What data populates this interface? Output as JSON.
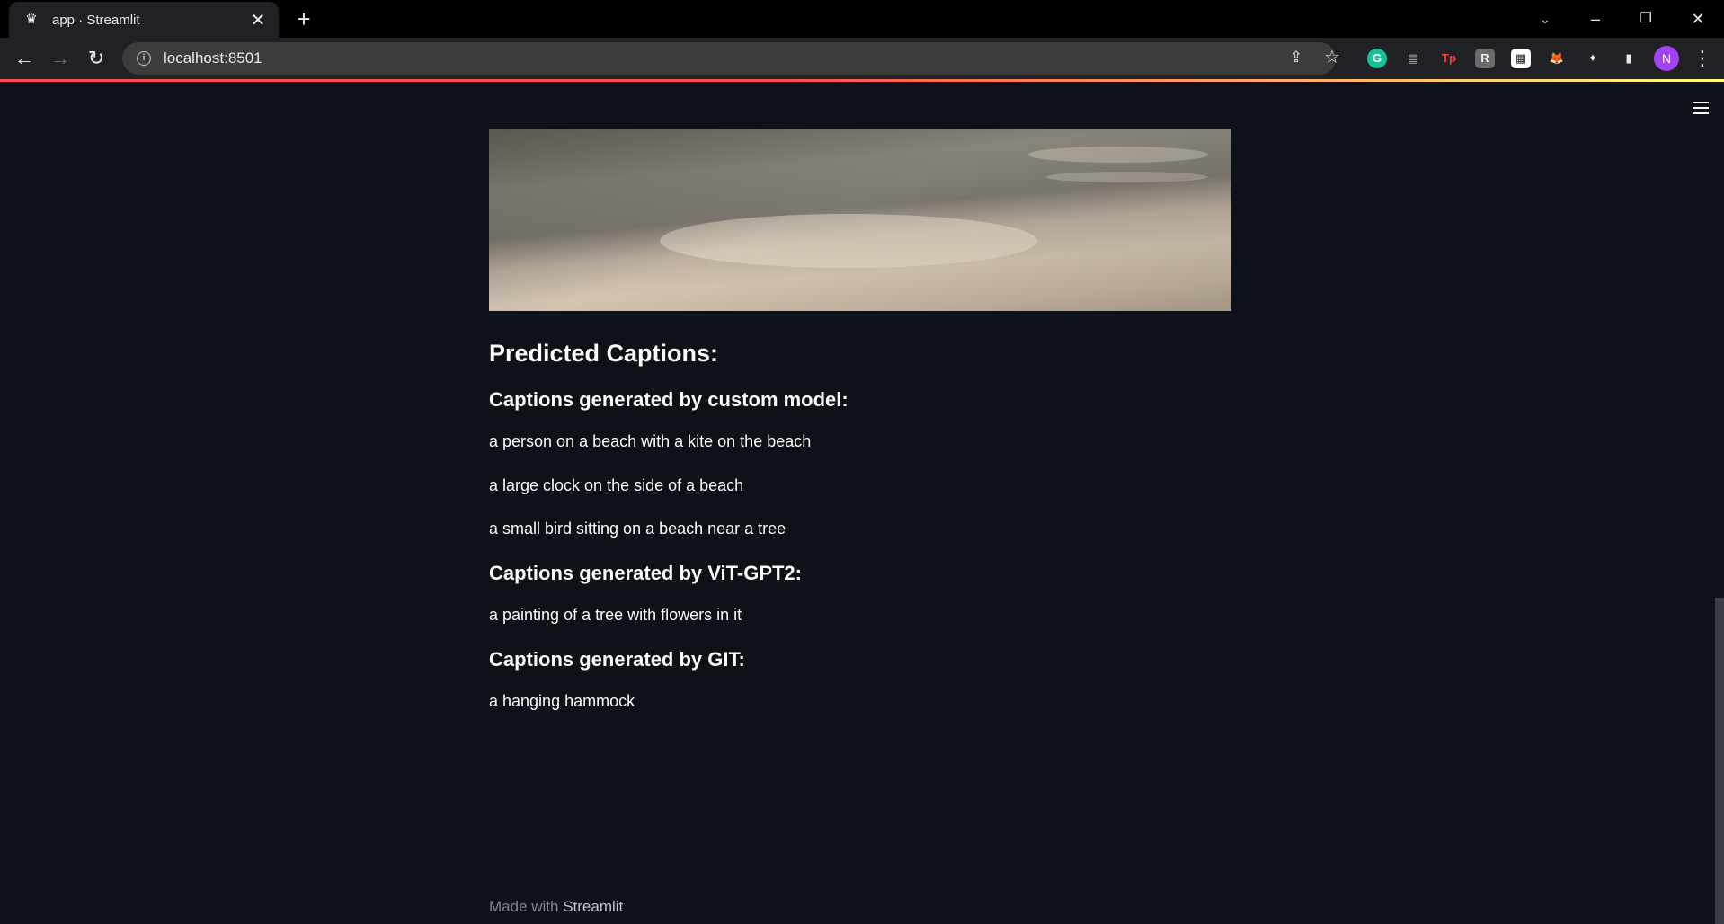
{
  "browser": {
    "tab_title": "app · Streamlit",
    "favicon_glyph": "♛",
    "close_glyph": "✕",
    "new_tab_glyph": "+",
    "url": "localhost:8501",
    "avatar_letter": "N",
    "extensions": [
      {
        "name": "grammarly-icon",
        "glyph": "G",
        "bg": "#15c39a",
        "fg": "#ffffff"
      },
      {
        "name": "clipboard-icon",
        "glyph": "▤",
        "bg": "transparent",
        "fg": "#c4c7c5"
      },
      {
        "name": "tp-icon",
        "glyph": "Tp",
        "bg": "transparent",
        "fg": "#ff3b3b"
      },
      {
        "name": "r-extension-icon",
        "glyph": "R",
        "bg": "#6b6b6b",
        "fg": "#e8eaed"
      },
      {
        "name": "qr-code-icon",
        "glyph": "▦",
        "bg": "#ffffff",
        "fg": "#202124"
      },
      {
        "name": "metamask-icon",
        "glyph": "🦊",
        "bg": "transparent",
        "fg": "#f6851b"
      },
      {
        "name": "puzzle-icon",
        "glyph": "✦",
        "bg": "transparent",
        "fg": "#e8eaed"
      },
      {
        "name": "side-panel-icon",
        "glyph": "▮",
        "bg": "transparent",
        "fg": "#e8eaed"
      }
    ]
  },
  "app": {
    "section_title": "Predicted Captions:",
    "groups": [
      {
        "heading": "Captions generated by custom model:",
        "captions": [
          "a person on a beach with a kite on the beach",
          "a large clock on the side of a beach",
          "a small bird sitting on a beach near a tree"
        ]
      },
      {
        "heading": "Captions generated by ViT-GPT2:",
        "captions": [
          "a painting of a tree with flowers in it"
        ]
      },
      {
        "heading": "Captions generated by GIT:",
        "captions": [
          "a hanging hammock"
        ]
      }
    ],
    "footer_prefix": "Made with ",
    "footer_brand": "Streamlit"
  },
  "colors": {
    "accent": "#ff4b4b",
    "background": "#0e1117",
    "text": "#fafafa"
  }
}
